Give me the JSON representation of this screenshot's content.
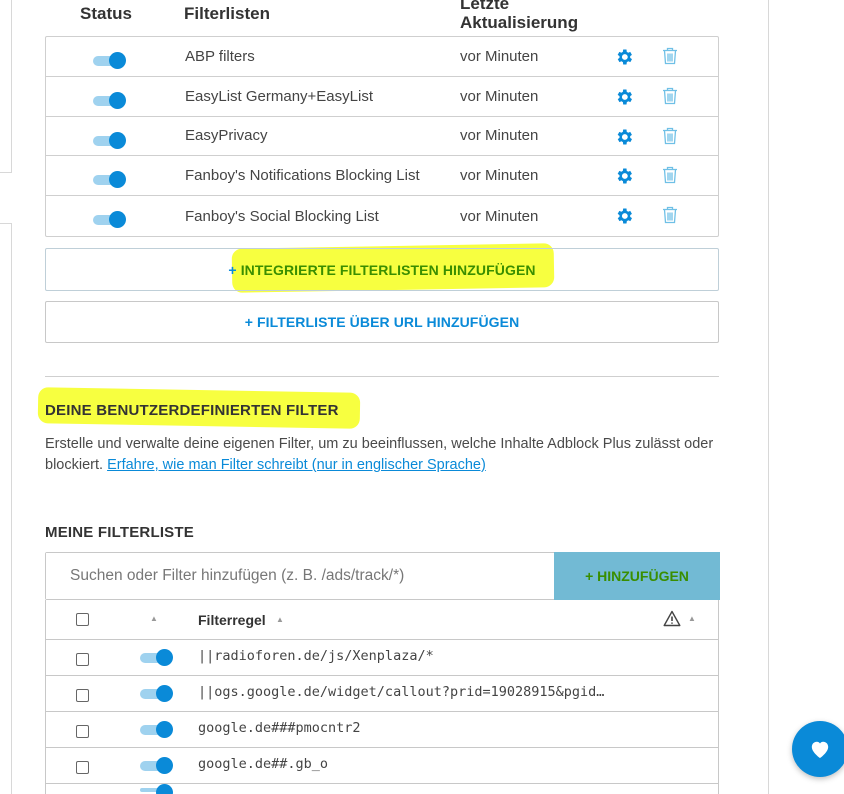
{
  "header": {
    "status": "Status",
    "filterlists": "Filterlisten",
    "last_update_line1": "Letzte",
    "last_update_line2": "Aktualisierung"
  },
  "subscriptions": [
    {
      "name": "ABP filters",
      "updated": "vor Minuten",
      "enabled": true
    },
    {
      "name": "EasyList Germany+EasyList",
      "updated": "vor Minuten",
      "enabled": true
    },
    {
      "name": "EasyPrivacy",
      "updated": "vor Minuten",
      "enabled": true
    },
    {
      "name": "Fanboy's Notifications Blocking List",
      "updated": "vor Minuten",
      "enabled": true
    },
    {
      "name": "Fanboy's Social Blocking List",
      "updated": "vor Minuten",
      "enabled": true
    }
  ],
  "buttons": {
    "add_builtin_plus": "+",
    "add_builtin": "INTEGRIERTE FILTERLISTEN HINZUFÜGEN",
    "add_url": "+ FILTERLISTE ÜBER URL HINZUFÜGEN",
    "add_filter": "+ HINZUFÜGEN"
  },
  "custom": {
    "title": "DEINE BENUTZERDEFINIERTEN FILTER",
    "desc": "Erstelle und verwalte deine eigenen Filter, um zu beeinflussen, welche Inhalte Adblock Plus zulässt oder blockiert.",
    "link": "Erfahre, wie man Filter schreibt (nur in englischer Sprache)",
    "my_list_title": "MEINE FILTERLISTE",
    "search_placeholder": "Suchen oder Filter hinzufügen (z. B. /ads/track/*)",
    "column_rule": "Filterregel"
  },
  "rules": [
    {
      "text": "||radioforen.de/js/Xenplaza/*",
      "enabled": true
    },
    {
      "text": "||ogs.google.de/widget/callout?prid=19028915&pgid…",
      "enabled": true
    },
    {
      "text": "google.de###pmocntr2",
      "enabled": true
    },
    {
      "text": "google.de##.gb_o",
      "enabled": true
    }
  ],
  "colors": {
    "accent": "#0a8ad8",
    "highlight": "#f6ff2b",
    "add_button": "#72bad4"
  },
  "icons": [
    "gear-icon",
    "trash-icon",
    "warning-icon",
    "heart-icon",
    "sort-arrow-icon"
  ]
}
